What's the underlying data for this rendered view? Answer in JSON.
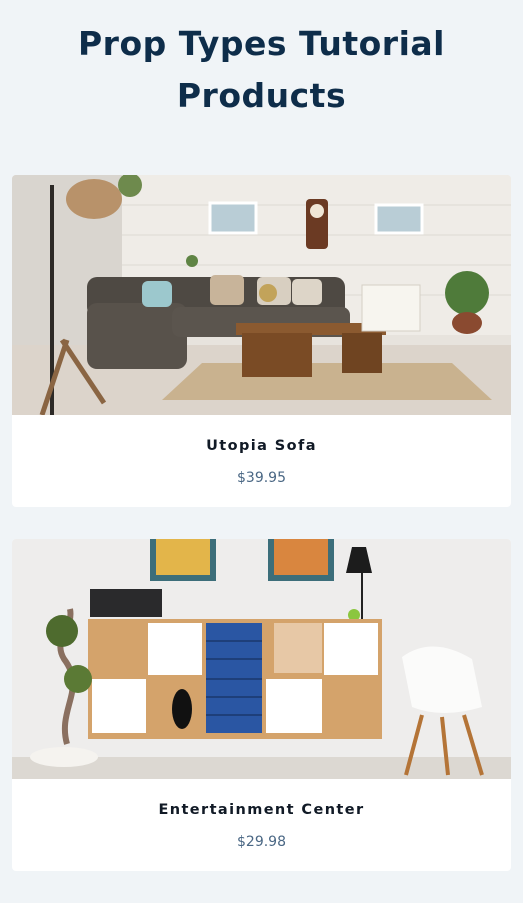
{
  "header": {
    "title": "Prop Types Tutorial Products"
  },
  "products": [
    {
      "name": "Utopia Sofa",
      "price": "$39.95",
      "image": "living-room-sofa-photo"
    },
    {
      "name": "Entertainment Center",
      "price": "$29.98",
      "image": "entertainment-center-photo"
    }
  ]
}
